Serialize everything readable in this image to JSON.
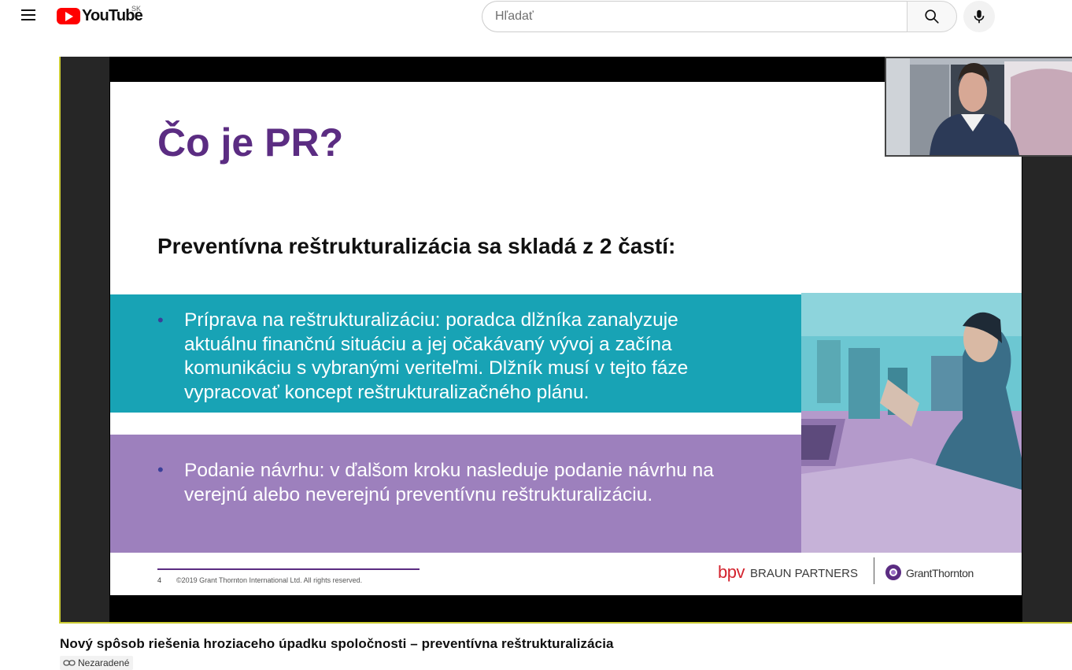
{
  "header": {
    "logo_text": "YouTube",
    "country_code": "SK",
    "search_placeholder": "Hľadať"
  },
  "slide": {
    "title": "Čo je PR?",
    "subtitle": "Preventívna reštrukturalizácia sa skladá z 2 častí:",
    "bullet_symbol": "•",
    "bullets": [
      "Príprava na reštrukturalizáciu: poradca dlžníka zanalyzuje aktuálnu finančnú situáciu a jej očakávaný vývoj a začína komunikáciu s vybranými veriteľmi. Dlžník musí v tejto fáze vypracovať koncept reštrukturalizačného plánu.",
      "Podanie návrhu: v ďalšom kroku nasleduje podanie návrhu na verejnú alebo neverejnú preventívnu reštrukturalizáciu."
    ],
    "footer": {
      "page_number": "4",
      "copyright": "©2019 Grant Thornton International Ltd. All rights reserved.",
      "brand1_short": "bpv",
      "brand1_name": "BRAUN PARTNERS",
      "brand2_name": "GrantThornton"
    }
  },
  "video": {
    "title": "Nový spôsob riešenia hroziaceho úpadku spoločnosti – preventívna reštrukturalizácia",
    "visibility": "Nezaradené"
  },
  "icons": {
    "menu": "menu-icon",
    "search": "search-icon",
    "mic": "mic-icon",
    "link": "link-icon"
  },
  "colors": {
    "brand_red": "#ff0000",
    "slide_purple": "#5b2c82",
    "teal_band": "#18a3b5",
    "purple_band": "#9d80bd",
    "bpv_red": "#d4242f"
  }
}
